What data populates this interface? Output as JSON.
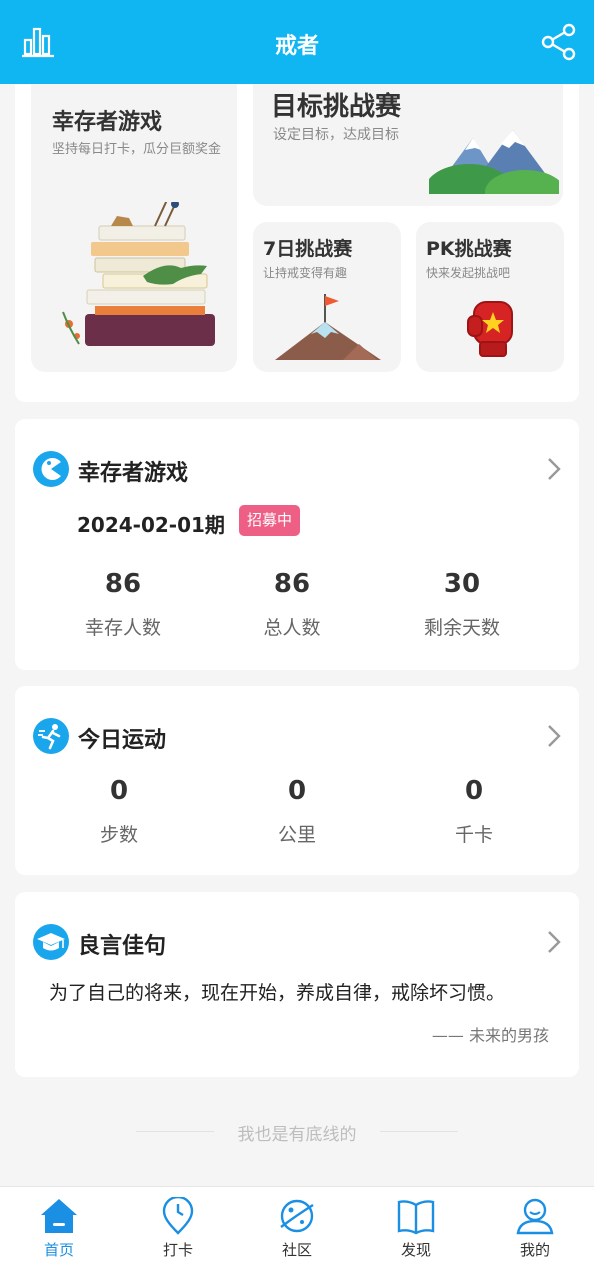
{
  "header": {
    "title": "戒者"
  },
  "banner": {
    "survivor": {
      "title": "幸存者游戏",
      "subtitle": "坚持每日打卡，瓜分巨额奖金"
    },
    "target": {
      "title": "目标挑战赛",
      "subtitle": "设定目标，达成目标"
    },
    "seven_day": {
      "title": "7日挑战赛",
      "subtitle": "让持戒变得有趣"
    },
    "pk": {
      "title": "PK挑战赛",
      "subtitle": "快来发起挑战吧"
    }
  },
  "survivor_game": {
    "title": "幸存者游戏",
    "period": "2024-02-01期",
    "status": "招募中",
    "stats": [
      {
        "value": "86",
        "label": "幸存人数"
      },
      {
        "value": "86",
        "label": "总人数"
      },
      {
        "value": "30",
        "label": "剩余天数"
      }
    ]
  },
  "today_exercise": {
    "title": "今日运动",
    "stats": [
      {
        "value": "0",
        "label": "步数"
      },
      {
        "value": "0",
        "label": "公里"
      },
      {
        "value": "0",
        "label": "千卡"
      }
    ]
  },
  "quote": {
    "title": "良言佳句",
    "text": "为了自己的将来，现在开始，养成自律，戒除坏习惯。",
    "author": "—— 未来的男孩"
  },
  "footer_note": "我也是有底线的",
  "tabs": [
    {
      "label": "首页",
      "icon": "home-icon",
      "active": true
    },
    {
      "label": "打卡",
      "icon": "checkin-icon",
      "active": false
    },
    {
      "label": "社区",
      "icon": "community-icon",
      "active": false
    },
    {
      "label": "发现",
      "icon": "discover-icon",
      "active": false
    },
    {
      "label": "我的",
      "icon": "profile-icon",
      "active": false
    }
  ],
  "colors": {
    "brand": "#0fb6f2",
    "badge": "#ee5f86",
    "tab_active": "#1a8fe3"
  }
}
